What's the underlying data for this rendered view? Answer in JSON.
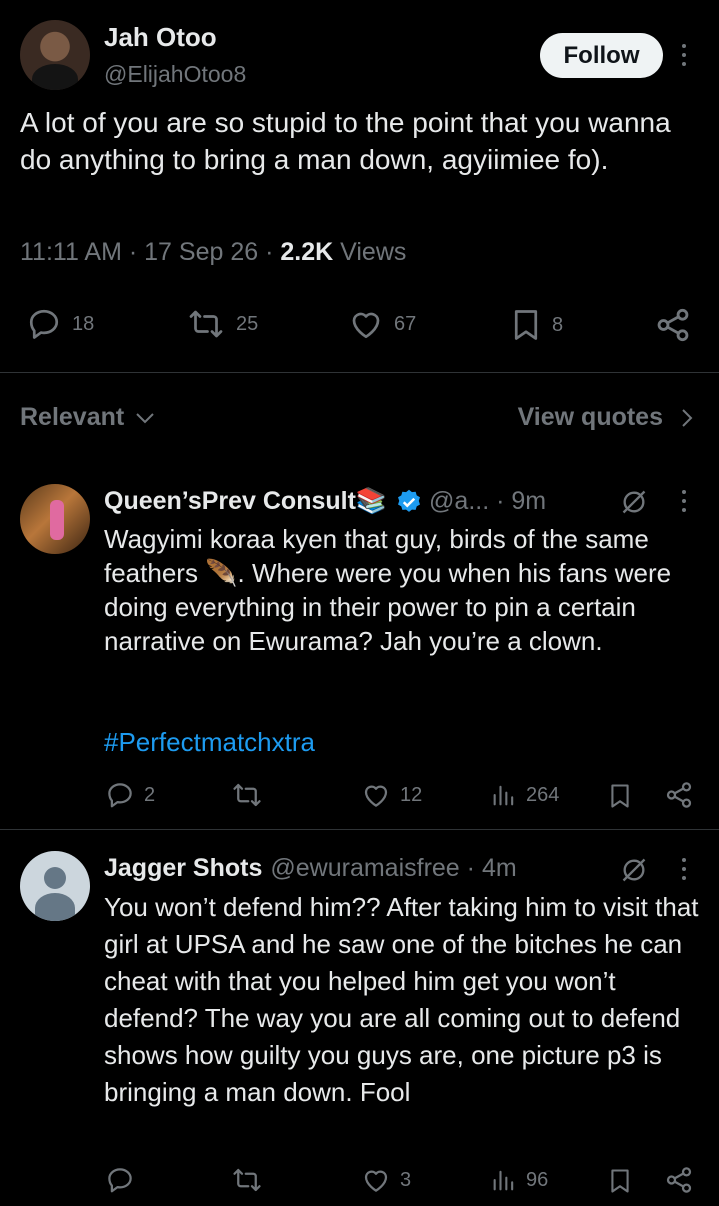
{
  "main_tweet": {
    "author_name": "Jah Otoo",
    "author_handle": "@ElijahOtoo8",
    "follow_label": "Follow",
    "text": "A lot of you are so stupid to the point that you wanna do anything to bring a man down, agyiimiee fo).",
    "time": "11:11 AM",
    "date": "17 Sep 26",
    "views_count": "2.2K",
    "views_label": "Views",
    "replies": "18",
    "reposts": "25",
    "likes": "67",
    "bookmarks": "8"
  },
  "filters": {
    "sort_label": "Relevant",
    "quotes_label": "View quotes"
  },
  "replies": [
    {
      "author_name": "Queen’sPrev Consult📚",
      "author_handle": "@a...",
      "time": "9m",
      "text": "Wagyimi koraa kyen that guy, birds of the same feathers 🪶. Where were you when his fans were doing everything in their power to pin a certain narrative on Ewurama? Jah you’re a clown.",
      "hashtag": "#Perfectmatchxtra",
      "replies": "2",
      "reposts": "",
      "likes": "12",
      "views": "264"
    },
    {
      "author_name": "Jagger Shots",
      "author_handle": "@ewuramaisfree",
      "time": "4m",
      "text": "You won’t defend him?? After taking him to visit that girl at UPSA  and he saw one of the bitches he can cheat with that you helped him get you won’t defend? The way you are all coming out to defend shows how guilty you guys are, one picture p3 is bringing a man down. Fool",
      "replies": "",
      "reposts": "",
      "likes": "3",
      "views": "96"
    }
  ],
  "colors": {
    "background": "#000000",
    "text": "#e7e9ea",
    "muted": "#71767b",
    "link": "#1d9bf0",
    "verified": "#1d9bf0",
    "divider": "#2f3336",
    "follow_bg": "#eff3f4"
  },
  "icons": [
    "reply-icon",
    "repost-icon",
    "like-icon",
    "bookmark-icon",
    "share-icon",
    "views-icon",
    "verified-badge-icon",
    "grok-icon",
    "more-icon",
    "chevron-down-icon",
    "chevron-right-icon"
  ]
}
